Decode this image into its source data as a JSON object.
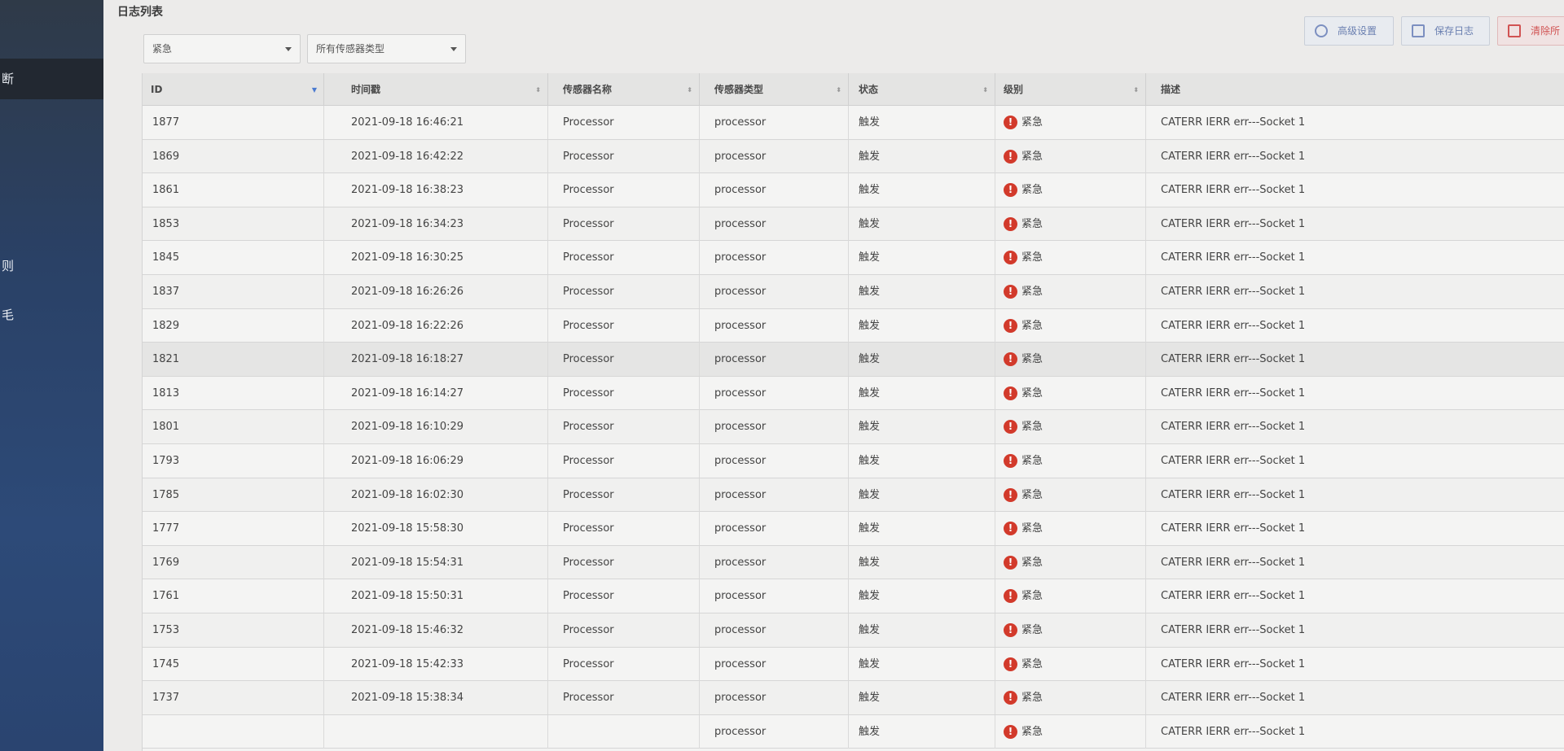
{
  "sidebar": {
    "items": [
      {
        "label": "断",
        "active": true
      },
      {
        "label": "则",
        "active": false
      },
      {
        "label": "毛",
        "active": false
      }
    ]
  },
  "page": {
    "title": "日志列表"
  },
  "filters": {
    "level_select": "紧急",
    "sensor_type_select": "所有传感器类型"
  },
  "toolbar": {
    "advanced_label": "高级设置",
    "save_label": "保存日志",
    "clear_label": "清除所"
  },
  "table": {
    "columns": [
      "ID",
      "时间戳",
      "传感器名称",
      "传感器类型",
      "状态",
      "级别",
      "描述"
    ],
    "rows": [
      {
        "id": "1877",
        "time": "2021-09-18 16:46:21",
        "name": "Processor",
        "type": "processor",
        "status": "触发",
        "level": "紧急",
        "desc": "CATERR IERR err---Socket 1"
      },
      {
        "id": "1869",
        "time": "2021-09-18 16:42:22",
        "name": "Processor",
        "type": "processor",
        "status": "触发",
        "level": "紧急",
        "desc": "CATERR IERR err---Socket 1"
      },
      {
        "id": "1861",
        "time": "2021-09-18 16:38:23",
        "name": "Processor",
        "type": "processor",
        "status": "触发",
        "level": "紧急",
        "desc": "CATERR IERR err---Socket 1"
      },
      {
        "id": "1853",
        "time": "2021-09-18 16:34:23",
        "name": "Processor",
        "type": "processor",
        "status": "触发",
        "level": "紧急",
        "desc": "CATERR IERR err---Socket 1"
      },
      {
        "id": "1845",
        "time": "2021-09-18 16:30:25",
        "name": "Processor",
        "type": "processor",
        "status": "触发",
        "level": "紧急",
        "desc": "CATERR IERR err---Socket 1"
      },
      {
        "id": "1837",
        "time": "2021-09-18 16:26:26",
        "name": "Processor",
        "type": "processor",
        "status": "触发",
        "level": "紧急",
        "desc": "CATERR IERR err---Socket 1"
      },
      {
        "id": "1829",
        "time": "2021-09-18 16:22:26",
        "name": "Processor",
        "type": "processor",
        "status": "触发",
        "level": "紧急",
        "desc": "CATERR IERR err---Socket 1"
      },
      {
        "id": "1821",
        "time": "2021-09-18 16:18:27",
        "name": "Processor",
        "type": "processor",
        "status": "触发",
        "level": "紧急",
        "desc": "CATERR IERR err---Socket 1"
      },
      {
        "id": "1813",
        "time": "2021-09-18 16:14:27",
        "name": "Processor",
        "type": "processor",
        "status": "触发",
        "level": "紧急",
        "desc": "CATERR IERR err---Socket 1"
      },
      {
        "id": "1801",
        "time": "2021-09-18 16:10:29",
        "name": "Processor",
        "type": "processor",
        "status": "触发",
        "level": "紧急",
        "desc": "CATERR IERR err---Socket 1"
      },
      {
        "id": "1793",
        "time": "2021-09-18 16:06:29",
        "name": "Processor",
        "type": "processor",
        "status": "触发",
        "level": "紧急",
        "desc": "CATERR IERR err---Socket 1"
      },
      {
        "id": "1785",
        "time": "2021-09-18 16:02:30",
        "name": "Processor",
        "type": "processor",
        "status": "触发",
        "level": "紧急",
        "desc": "CATERR IERR err---Socket 1"
      },
      {
        "id": "1777",
        "time": "2021-09-18 15:58:30",
        "name": "Processor",
        "type": "processor",
        "status": "触发",
        "level": "紧急",
        "desc": "CATERR IERR err---Socket 1"
      },
      {
        "id": "1769",
        "time": "2021-09-18 15:54:31",
        "name": "Processor",
        "type": "processor",
        "status": "触发",
        "level": "紧急",
        "desc": "CATERR IERR err---Socket 1"
      },
      {
        "id": "1761",
        "time": "2021-09-18 15:50:31",
        "name": "Processor",
        "type": "processor",
        "status": "触发",
        "level": "紧急",
        "desc": "CATERR IERR err---Socket 1"
      },
      {
        "id": "1753",
        "time": "2021-09-18 15:46:32",
        "name": "Processor",
        "type": "processor",
        "status": "触发",
        "level": "紧急",
        "desc": "CATERR IERR err---Socket 1"
      },
      {
        "id": "1745",
        "time": "2021-09-18 15:42:33",
        "name": "Processor",
        "type": "processor",
        "status": "触发",
        "level": "紧急",
        "desc": "CATERR IERR err---Socket 1"
      },
      {
        "id": "1737",
        "time": "2021-09-18 15:38:34",
        "name": "Processor",
        "type": "processor",
        "status": "触发",
        "level": "紧急",
        "desc": "CATERR IERR err---Socket 1"
      },
      {
        "id": "",
        "time": "",
        "name": "",
        "type": "processor",
        "status": "触发",
        "level": "紧急",
        "desc": "CATERR IERR err---Socket 1"
      }
    ]
  },
  "icons": {
    "alert": "!",
    "sort_both": "⬍",
    "sort_desc": "▼"
  },
  "colors": {
    "sidebar_bg": "#2a4166",
    "sidebar_active": "#222831",
    "alert_red": "#d23a2b",
    "primary_blue": "#6a7fb0",
    "danger": "#d15353"
  }
}
